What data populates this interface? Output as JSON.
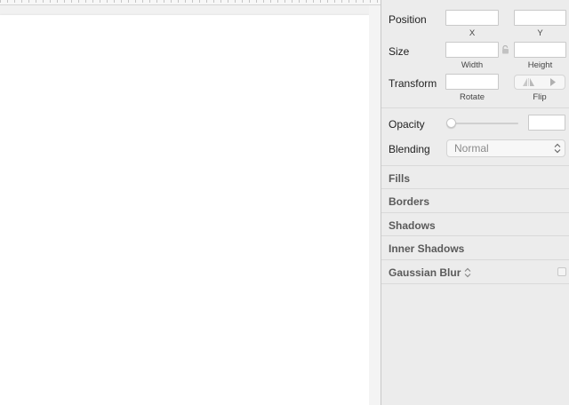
{
  "inspector": {
    "position_label": "Position",
    "x_label": "X",
    "y_label": "Y",
    "size_label": "Size",
    "width_label": "Width",
    "height_label": "Height",
    "transform_label": "Transform",
    "rotate_label": "Rotate",
    "flip_label": "Flip",
    "opacity_label": "Opacity",
    "opacity_level": 0,
    "blending_label": "Blending",
    "blending_value": "Normal",
    "sections": {
      "fills": "Fills",
      "borders": "Borders",
      "shadows": "Shadows",
      "inner_shadows": "Inner Shadows",
      "gaussian_blur": "Gaussian Blur"
    }
  },
  "icons": {
    "lock": "lock-icon",
    "flip": "flip-icon",
    "blending_chevron": "chevron-updown-icon",
    "blur_type": "chevron-updown-icon",
    "blur_toggle": "checkbox-icon"
  },
  "colors": {
    "panel_bg": "#ececec",
    "artboard_bg": "#ffffff",
    "section_text": "#5a5a5a"
  }
}
